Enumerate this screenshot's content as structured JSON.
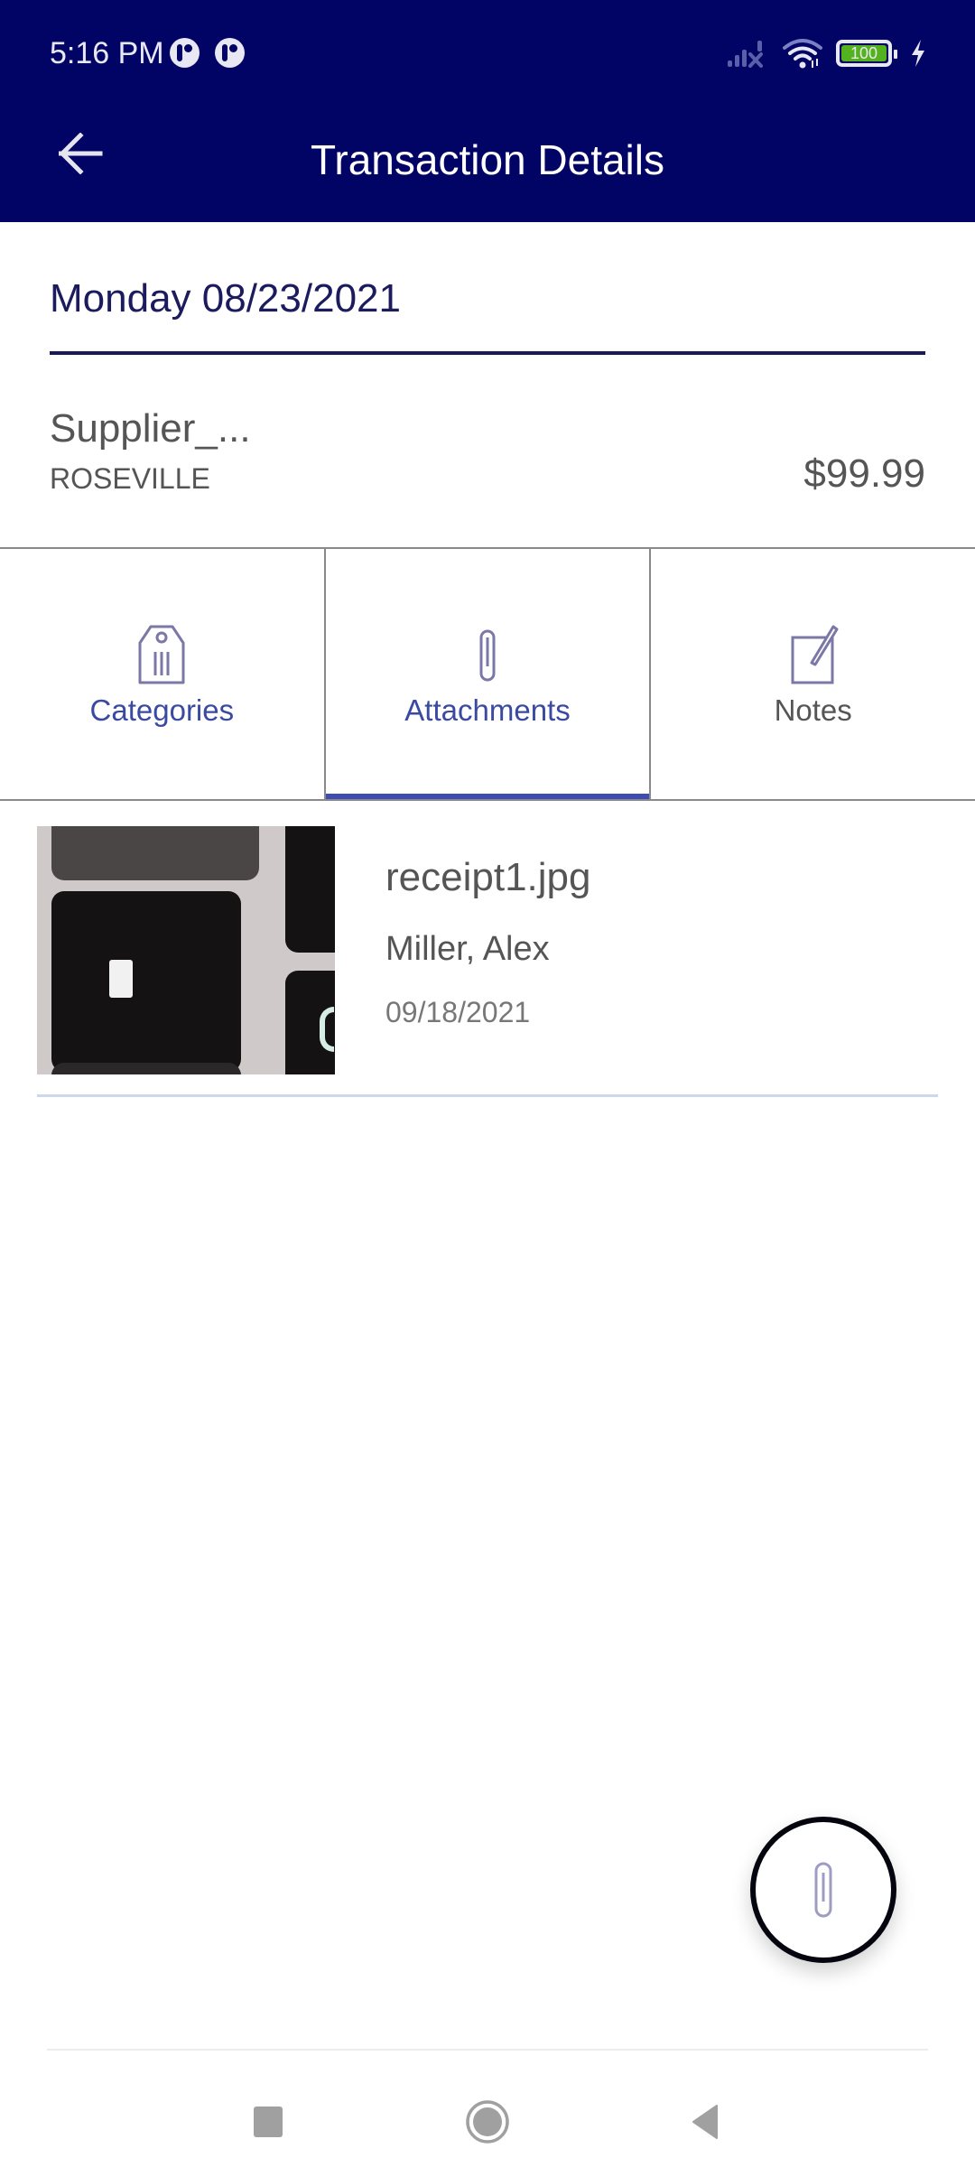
{
  "status_bar": {
    "time": "5:16 PM",
    "notification_icons": [
      "app-notification-icon",
      "app-notification-icon"
    ],
    "battery_level": "100",
    "icons": [
      "signal-icon",
      "wifi-icon",
      "battery-icon",
      "charging-icon"
    ]
  },
  "header": {
    "title": "Transaction Details",
    "back_icon": "arrow-left-icon"
  },
  "transaction": {
    "date": "Monday 08/23/2021",
    "supplier": "Supplier_...",
    "city": "ROSEVILLE",
    "amount": "$99.99"
  },
  "tabs": [
    {
      "label": "Categories",
      "icon": "tag-icon",
      "active": false
    },
    {
      "label": "Attachments",
      "icon": "paperclip-icon",
      "active": true
    },
    {
      "label": "Notes",
      "icon": "note-edit-icon",
      "active": false
    }
  ],
  "attachments": [
    {
      "file_name": "receipt1.jpg",
      "author": "Miller, Alex",
      "date": "09/18/2021",
      "thumbnail": "keyboard-photo"
    }
  ],
  "fab": {
    "icon": "paperclip-icon",
    "action": "add-attachment"
  },
  "nav_bar": {
    "buttons": [
      "recents-square-icon",
      "home-circle-icon",
      "back-triangle-icon"
    ]
  },
  "colors": {
    "header_bg": "#020465",
    "accent": "#3f4cb1",
    "tab_text": "#3a4aa0",
    "date_text": "#1b1b5e",
    "battery": "#54b21f"
  }
}
